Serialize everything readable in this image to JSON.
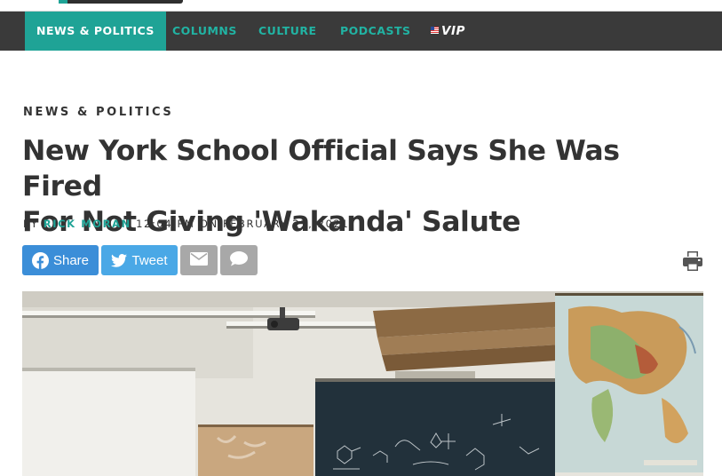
{
  "nav": {
    "items": [
      {
        "label": "NEWS & POLITICS",
        "active": true
      },
      {
        "label": "COLUMNS",
        "active": false
      },
      {
        "label": "CULTURE",
        "active": false
      },
      {
        "label": "PODCASTS",
        "active": false
      }
    ],
    "vip_label": "VIP"
  },
  "article": {
    "section": "NEWS & POLITICS",
    "headline_line1": "New York School Official Says She Was Fired",
    "headline_line2": "For Not Giving 'Wakanda' Salute",
    "byline_prefix": "BY",
    "author": "RICK MORAN",
    "timestamp": "12:04 PM ON FEBRUARY 21, 2021"
  },
  "share": {
    "facebook_label": "Share",
    "twitter_label": "Tweet",
    "email_icon": "envelope-icon",
    "comment_icon": "comment-icon",
    "print_icon": "print-icon"
  },
  "colors": {
    "nav_bg": "#3a3a3a",
    "accent": "#1fa396",
    "facebook": "#3b8ed8",
    "twitter": "#4aa8e6",
    "gray_button": "#a8a8a8"
  }
}
